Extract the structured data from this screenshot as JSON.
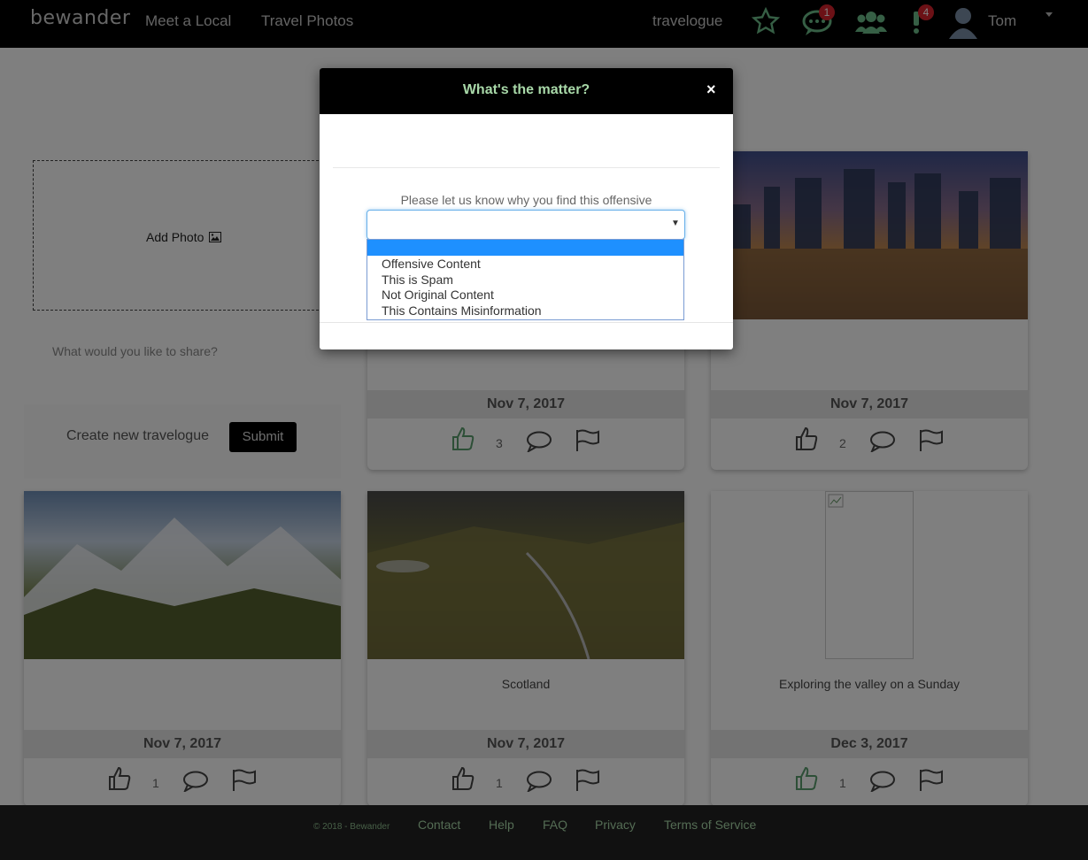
{
  "nav": {
    "brand": "bewander",
    "links": [
      "Meet a Local",
      "Travel Photos"
    ],
    "travelogue": "travelogue",
    "messages_badge": "1",
    "alerts_badge": "4",
    "user_name": "Tom"
  },
  "add_card": {
    "add_photo_label": "Add Photo",
    "share_placeholder": "What would you like to share?",
    "create_label": "Create new travelogue",
    "submit_label": "Submit"
  },
  "cards": [
    {
      "date": "Nov 7, 2017",
      "likes": "3",
      "caption": "",
      "liked": true
    },
    {
      "date": "Nov 7, 2017",
      "likes": "2",
      "caption": "",
      "liked": false
    },
    {
      "date": "Nov 7, 2017",
      "likes": "1",
      "caption": "",
      "liked": false
    },
    {
      "date": "Nov 7, 2017",
      "likes": "1",
      "caption": "Scotland",
      "liked": false
    },
    {
      "date": "Dec 3, 2017",
      "likes": "1",
      "caption": "Exploring the valley on a Sunday",
      "liked": true
    }
  ],
  "footer": {
    "copyright": "© 2018 - Bewander",
    "links": [
      "Contact",
      "Help",
      "FAQ",
      "Privacy",
      "Terms of Service"
    ]
  },
  "modal": {
    "title": "What's the matter?",
    "close": "×",
    "prompt": "Please let us know why you find this offensive",
    "options": [
      "",
      "Offensive Content",
      "This is Spam",
      "Not Original Content",
      "This Contains Misinformation"
    ]
  },
  "colors": {
    "accent_green": "#a8d8a8",
    "liked_green": "#5a9e6f",
    "badge_red": "#d9232d",
    "select_highlight": "#1e90ff"
  }
}
